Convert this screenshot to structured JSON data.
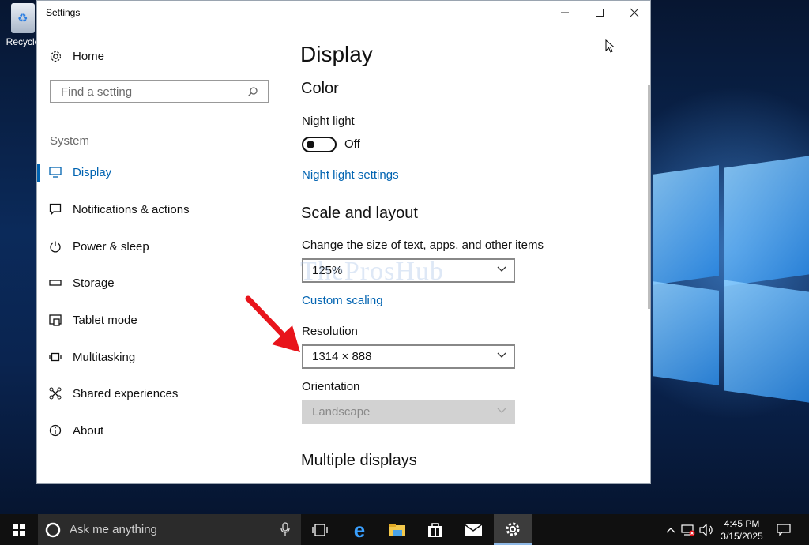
{
  "desktop": {
    "recycle_bin_label": "Recycle"
  },
  "window": {
    "title": "Settings",
    "minimize_label": "—",
    "maximize_label": "☐",
    "close_label": "✕"
  },
  "sidebar": {
    "home_label": "Home",
    "search_placeholder": "Find a setting",
    "section_label": "System",
    "items": [
      {
        "label": "Display",
        "icon": "monitor-icon",
        "selected": true
      },
      {
        "label": "Notifications & actions",
        "icon": "notification-icon"
      },
      {
        "label": "Power & sleep",
        "icon": "power-icon"
      },
      {
        "label": "Storage",
        "icon": "storage-icon"
      },
      {
        "label": "Tablet mode",
        "icon": "tablet-icon"
      },
      {
        "label": "Multitasking",
        "icon": "multitasking-icon"
      },
      {
        "label": "Shared experiences",
        "icon": "shared-icon"
      },
      {
        "label": "About",
        "icon": "info-icon"
      }
    ]
  },
  "content": {
    "page_title": "Display",
    "color_heading": "Color",
    "night_light_label": "Night light",
    "night_light_state": "Off",
    "night_light_settings_link": "Night light settings",
    "scale_heading": "Scale and layout",
    "scale_label": "Change the size of text, apps, and other items",
    "scale_value": "125%",
    "custom_scaling_link": "Custom scaling",
    "resolution_label": "Resolution",
    "resolution_value": "1314 × 888",
    "orientation_label": "Orientation",
    "orientation_value": "Landscape",
    "multiple_displays_heading": "Multiple displays"
  },
  "watermark": "TheProsHub",
  "taskbar": {
    "search_placeholder": "Ask me anything",
    "time": "4:45 PM",
    "date": "3/15/2025"
  },
  "colors": {
    "accent": "#0063b1",
    "arrow": "#e8141b",
    "taskbar": "#101010"
  }
}
